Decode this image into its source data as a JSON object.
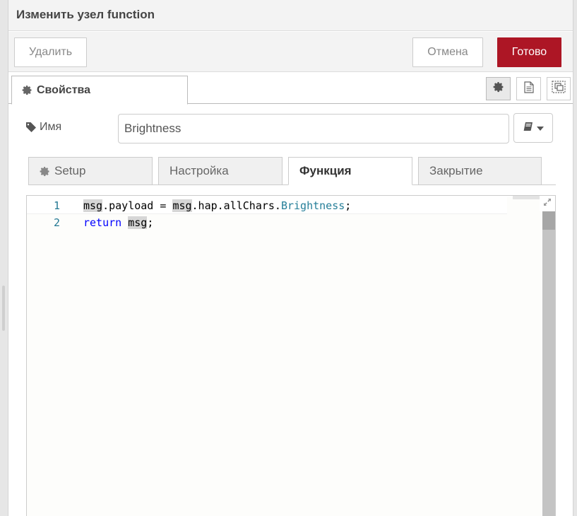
{
  "tray": {
    "title": "Изменить узел function"
  },
  "toolbar": {
    "delete_label": "Удалить",
    "cancel_label": "Отмена",
    "done_label": "Готово",
    "done_color": "#ad1625"
  },
  "tabs": {
    "properties_label": "Свойства",
    "icons": [
      "gear-icon",
      "description-icon",
      "appearance-icon"
    ]
  },
  "name_field": {
    "label": "Имя",
    "value": "Brightness"
  },
  "sub_tabs": [
    {
      "label": "Setup",
      "active": false
    },
    {
      "label": "Настройка",
      "active": false
    },
    {
      "label": "Функция",
      "active": true
    },
    {
      "label": "Закрытие",
      "active": false
    }
  ],
  "editor": {
    "lines": [
      {
        "number": "1",
        "text": "msg.payload = msg.hap.allChars.Brightness;"
      },
      {
        "number": "2",
        "text": "return msg;"
      }
    ],
    "tokens": {
      "msg": "msg",
      "payload_part": ".payload = ",
      "hap_part": ".hap.allChars.",
      "brightness": "Brightness",
      "semicolon": ";",
      "return_kw": "return",
      "space": " "
    }
  }
}
